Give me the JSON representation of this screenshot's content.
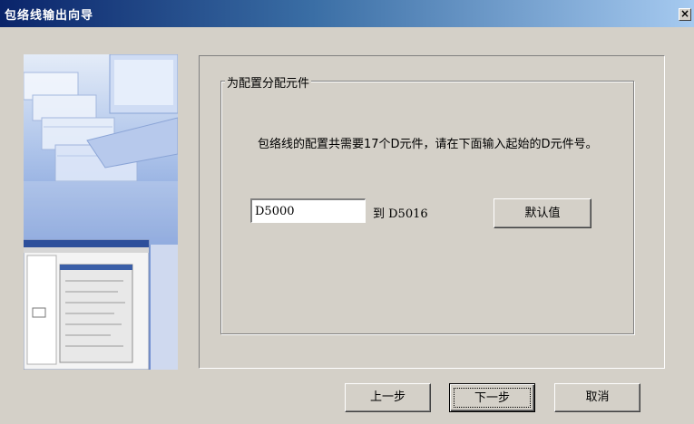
{
  "window": {
    "title": "包络线输出向导",
    "close_glyph": "×"
  },
  "group": {
    "legend": "为配置分配元件"
  },
  "description": "包络线的配置共需要17个D元件，请在下面输入起始的D元件号。",
  "start_input": {
    "value": "D5000"
  },
  "range_label": "到 D5016",
  "buttons": {
    "default": "默认值",
    "back": "上一步",
    "next": "下一步",
    "cancel": "取消"
  },
  "colors": {
    "titlebar_start": "#0a246a",
    "titlebar_end": "#a6caf0",
    "dialog_bg": "#d4d0c8"
  }
}
